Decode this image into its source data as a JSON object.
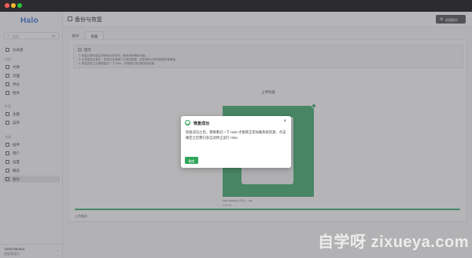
{
  "sidebar": {
    "logo": "Halo",
    "search_placeholder": "搜索",
    "search_shortcut": "⌘K",
    "dashboard": "仪表盘",
    "groups": [
      {
        "label": "内容",
        "items": [
          "文章",
          "页面",
          "评论",
          "附件"
        ]
      },
      {
        "label": "外观",
        "items": [
          "主题",
          "菜单"
        ]
      },
      {
        "label": "系统",
        "items": [
          "插件",
          "用户",
          "设置",
          "概览",
          "备份"
        ]
      }
    ],
    "user": {
      "name": "Administrator",
      "role": "超级管理员"
    }
  },
  "header": {
    "title": "备份与恢复",
    "create_button": "创建备份"
  },
  "tabs": [
    "备份",
    "恢复"
  ],
  "alert": {
    "title": "提示",
    "lines": [
      "1. 恢复过程可能会持续较长的时间，期间请勿刷新页面。",
      "2. 在恢复的过程中，虽然已经清理了已有的数据，但如果有冲突的数据将被覆盖。",
      "3. 恢复完成之后需要重启一下 Halo，才能够正常加载系统资源。"
    ]
  },
  "upload": {
    "title": "上传恢复",
    "file_name": "halo-backup-2023-....zip",
    "file_size": "240 KB"
  },
  "footer_link": "上传备份",
  "modal": {
    "title": "恢复成功",
    "body": "恢复成功之后，需要重启一下 Halo 才能够正常加载系统资源，点击确定之后我们会自动停止运行 Halo",
    "confirm": "确定"
  },
  "watermark": "自学呀 zixueya.com",
  "colors": {
    "accent": "#2ea65a",
    "logo": "#2d6ae0"
  }
}
